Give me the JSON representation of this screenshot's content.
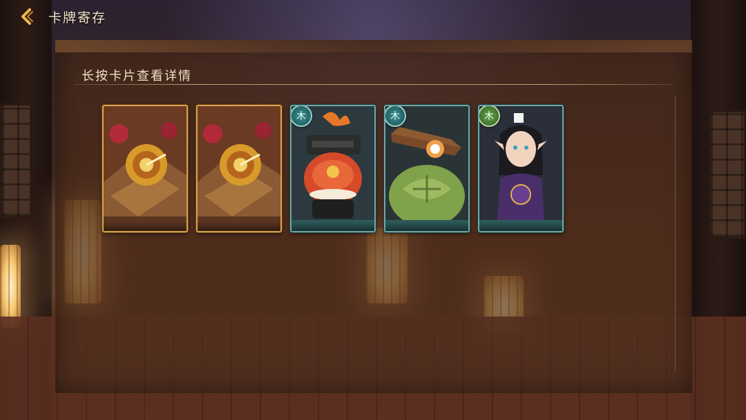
{
  "header": {
    "back_icon": "chevron-left-icon",
    "title": "卡牌寄存"
  },
  "panel": {
    "hint": "长按卡片查看详情"
  },
  "cards": [
    {
      "kind": "card-back",
      "frame": "gold"
    },
    {
      "kind": "card-back",
      "frame": "gold"
    },
    {
      "kind": "character",
      "frame": "teal",
      "element": "木",
      "element_color": "#2f7e80",
      "subject": "samurai-helmet-creature"
    },
    {
      "kind": "character",
      "frame": "teal",
      "element": "木",
      "element_color": "#2f7e80",
      "subject": "turtle-with-hat"
    },
    {
      "kind": "character",
      "frame": "teal",
      "element": "木",
      "element_color": "#4f8a3a",
      "subject": "horned-girl-in-purple"
    }
  ],
  "colors": {
    "panel_bg": "#4c2a1a",
    "text_light": "#f3e4c8",
    "gold_frame": "#d9a34a",
    "teal_frame": "#6fa8a6"
  }
}
